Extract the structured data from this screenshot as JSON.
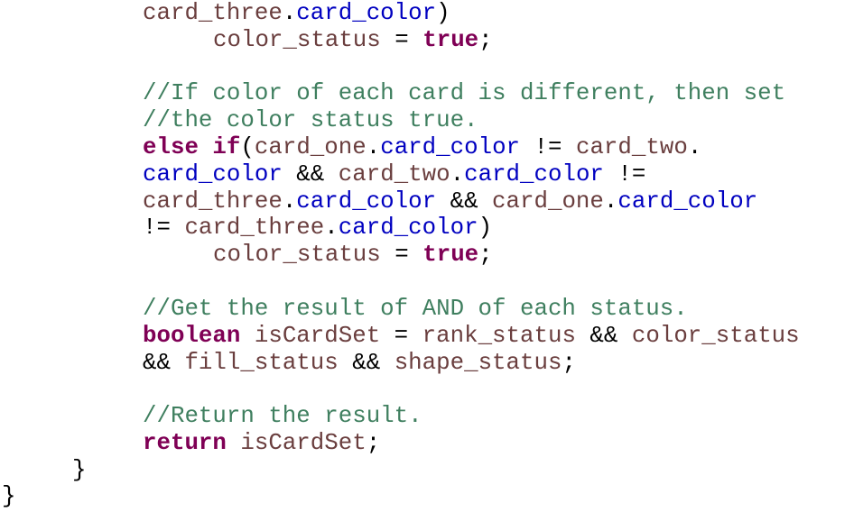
{
  "editor": {
    "lines": [
      {
        "indent": 1,
        "tokens": [
          {
            "t": "var",
            "s": "card_three"
          },
          {
            "t": "op",
            "s": "."
          },
          {
            "t": "field",
            "s": "card_color"
          },
          {
            "t": "op",
            "s": ")"
          }
        ]
      },
      {
        "indent": 2,
        "tokens": [
          {
            "t": "var",
            "s": "color_status"
          },
          {
            "t": "op",
            "s": " = "
          },
          {
            "t": "kw",
            "s": "true"
          },
          {
            "t": "op",
            "s": ";"
          }
        ]
      },
      {
        "indent": 1,
        "tokens": [
          {
            "t": "cm",
            "s": "//If color of each card is different, then set"
          }
        ]
      },
      {
        "indent": 1,
        "tokens": [
          {
            "t": "cm",
            "s": "//the color status true."
          }
        ]
      },
      {
        "indent": 1,
        "tokens": [
          {
            "t": "kw",
            "s": "else"
          },
          {
            "t": "op",
            "s": " "
          },
          {
            "t": "kw",
            "s": "if"
          },
          {
            "t": "op",
            "s": "("
          },
          {
            "t": "var",
            "s": "card_one"
          },
          {
            "t": "op",
            "s": "."
          },
          {
            "t": "field",
            "s": "card_color"
          },
          {
            "t": "op",
            "s": " != "
          },
          {
            "t": "var",
            "s": "card_two"
          },
          {
            "t": "op",
            "s": "."
          }
        ]
      },
      {
        "indent": 1,
        "tokens": [
          {
            "t": "field",
            "s": "card_color"
          },
          {
            "t": "op",
            "s": " && "
          },
          {
            "t": "var",
            "s": "card_two"
          },
          {
            "t": "op",
            "s": "."
          },
          {
            "t": "field",
            "s": "card_color"
          },
          {
            "t": "op",
            "s": " !="
          }
        ]
      },
      {
        "indent": 1,
        "tokens": [
          {
            "t": "var",
            "s": "card_three"
          },
          {
            "t": "op",
            "s": "."
          },
          {
            "t": "field",
            "s": "card_color"
          },
          {
            "t": "op",
            "s": " && "
          },
          {
            "t": "var",
            "s": "card_one"
          },
          {
            "t": "op",
            "s": "."
          },
          {
            "t": "field",
            "s": "card_color"
          }
        ]
      },
      {
        "indent": 1,
        "tokens": [
          {
            "t": "op",
            "s": "!= "
          },
          {
            "t": "var",
            "s": "card_three"
          },
          {
            "t": "op",
            "s": "."
          },
          {
            "t": "field",
            "s": "card_color"
          },
          {
            "t": "op",
            "s": ")"
          }
        ]
      },
      {
        "indent": 2,
        "tokens": [
          {
            "t": "var",
            "s": "color_status"
          },
          {
            "t": "op",
            "s": " = "
          },
          {
            "t": "kw",
            "s": "true"
          },
          {
            "t": "op",
            "s": ";"
          }
        ]
      },
      {
        "indent": 1,
        "tokens": [
          {
            "t": "cm",
            "s": "//Get the result of AND of each status."
          }
        ]
      },
      {
        "indent": 1,
        "tokens": [
          {
            "t": "kw",
            "s": "boolean"
          },
          {
            "t": "op",
            "s": " "
          },
          {
            "t": "var",
            "s": "isCardSet"
          },
          {
            "t": "op",
            "s": " = "
          },
          {
            "t": "var",
            "s": "rank_status"
          },
          {
            "t": "op",
            "s": " && "
          },
          {
            "t": "var",
            "s": "color_status"
          }
        ]
      },
      {
        "indent": 1,
        "tokens": [
          {
            "t": "op",
            "s": "&& "
          },
          {
            "t": "var",
            "s": "fill_status"
          },
          {
            "t": "op",
            "s": " && "
          },
          {
            "t": "var",
            "s": "shape_status"
          },
          {
            "t": "op",
            "s": ";"
          }
        ]
      },
      {
        "indent": 1,
        "tokens": [
          {
            "t": "cm",
            "s": "//Return the result."
          }
        ]
      },
      {
        "indent": 1,
        "tokens": [
          {
            "t": "kw",
            "s": "return"
          },
          {
            "t": "op",
            "s": " "
          },
          {
            "t": "var",
            "s": "isCardSet"
          },
          {
            "t": "op",
            "s": ";"
          }
        ]
      },
      {
        "indent": 0.5,
        "tokens": [
          {
            "t": "brace",
            "s": "}"
          }
        ]
      },
      {
        "indent": 0,
        "tokens": [
          {
            "t": "brace",
            "s": "}"
          }
        ]
      }
    ]
  },
  "colors": {
    "keyword": "#7f0055",
    "local_variable": "#6a3e3e",
    "field": "#0000c0",
    "comment": "#3f7f5f",
    "operator": "#000000",
    "background": "#ffffff"
  }
}
